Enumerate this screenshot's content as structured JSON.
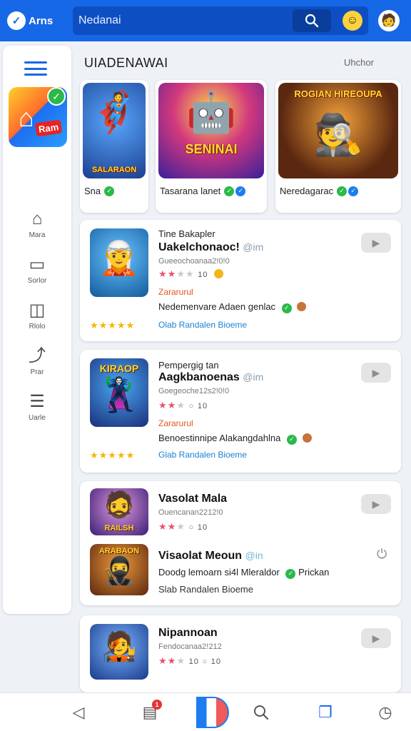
{
  "topbar": {
    "brand": "Arns",
    "search_placeholder": "Nedanai",
    "search_icon": "search-icon",
    "emoji_icon": "smiley-icon",
    "avatar_icon": "avatar-icon"
  },
  "sidebar": {
    "items": [
      {
        "label": "Mara",
        "icon": "home-icon",
        "glyph": "⌂"
      },
      {
        "label": "Sorlor",
        "icon": "folder-icon",
        "glyph": "▭"
      },
      {
        "label": "Rlolo",
        "icon": "gallery-icon",
        "glyph": "◫"
      },
      {
        "label": "Prar",
        "icon": "share-icon",
        "glyph": "⤴"
      },
      {
        "label": "Uarle",
        "icon": "list-icon",
        "glyph": "☰"
      }
    ],
    "featured_tag": "Ram"
  },
  "section": {
    "title": "UIADENAWAI",
    "link": "Uhchor"
  },
  "tiles": [
    {
      "name": "Sna",
      "art_title": "SALARAON",
      "art": "🦸",
      "verified": true,
      "bg": "#2f6cc6"
    },
    {
      "name": "Tasarana lanet",
      "art_title": "SENINAI",
      "art": "🤖",
      "verified": true,
      "bg": "#7a2bd6"
    },
    {
      "name": "Neredagarac",
      "art_title": "ROGIAN HIREOUPA",
      "art": "🕵️",
      "verified": true,
      "bg": "#8a4a1c"
    }
  ],
  "cards": [
    {
      "pre_title": "Tine Bakapler",
      "title": "Uakelchonaoc!",
      "title_suffix": "@im",
      "subtitle": "Gueeochoanaa2!0!0",
      "rating": 2,
      "rating_count": "10",
      "tag": "Zararurul",
      "description": "Nedemenvare Adaen genlac",
      "footer": "Olab Randalen Bioeme",
      "art_title": "",
      "art": "🧝",
      "bg": "#1d8ad9"
    },
    {
      "pre_title": "Pempergig tan",
      "title": "Aagkbanoenas",
      "title_suffix": "@im",
      "subtitle": "Goegeoche12s2!0!0",
      "rating": 2,
      "rating_count": "10",
      "tag": "Zararurul",
      "description": "Benoestinnipe Alakangdahlna",
      "footer": "Glab Randalen Bioeme",
      "art_title": "KIRAOP",
      "art": "🦹",
      "bg": "#2850a8"
    },
    {
      "pre_title": "",
      "title": "Vasolat Mala",
      "title_suffix": "",
      "subtitle": "Ouencanan2212!0",
      "rating": 2,
      "rating_count": "10",
      "tag": "",
      "description": "",
      "footer": "",
      "art_title": "RAILSH",
      "art": "🧔",
      "bg": "#7a3aa8"
    },
    {
      "pre_title": "",
      "title": "Visaolat Meoun",
      "title_suffix": "@in",
      "subtitle": "",
      "rating": 0,
      "rating_count": "",
      "tag": "",
      "description": "Doodg lemoarn si4l Mleraldor",
      "description_extra": "Prickan",
      "footer": "Slab Randalen Bioeme",
      "art_title": "ARABAON",
      "art": "🥷",
      "bg": "#8a4a1c"
    },
    {
      "pre_title": "",
      "title": "Nipannoan",
      "title_suffix": "",
      "subtitle": "Fendocanaa2!212",
      "rating": 2,
      "rating_count": "10",
      "tag": "",
      "description": "",
      "footer": "",
      "art_title": "",
      "art": "🧑‍🎤",
      "bg": "#2a5fc2"
    }
  ],
  "bottom_nav": {
    "badge": "1",
    "icons": [
      "back-icon",
      "inbox-icon",
      "home-icon",
      "search-icon",
      "copy-icon",
      "clock-icon"
    ]
  },
  "colors": {
    "brand_blue": "#1668e6",
    "verified_green": "#2bb94a",
    "star_pink": "#e8516f",
    "tag_orange": "#e0571f",
    "link_blue": "#1a82d4"
  }
}
